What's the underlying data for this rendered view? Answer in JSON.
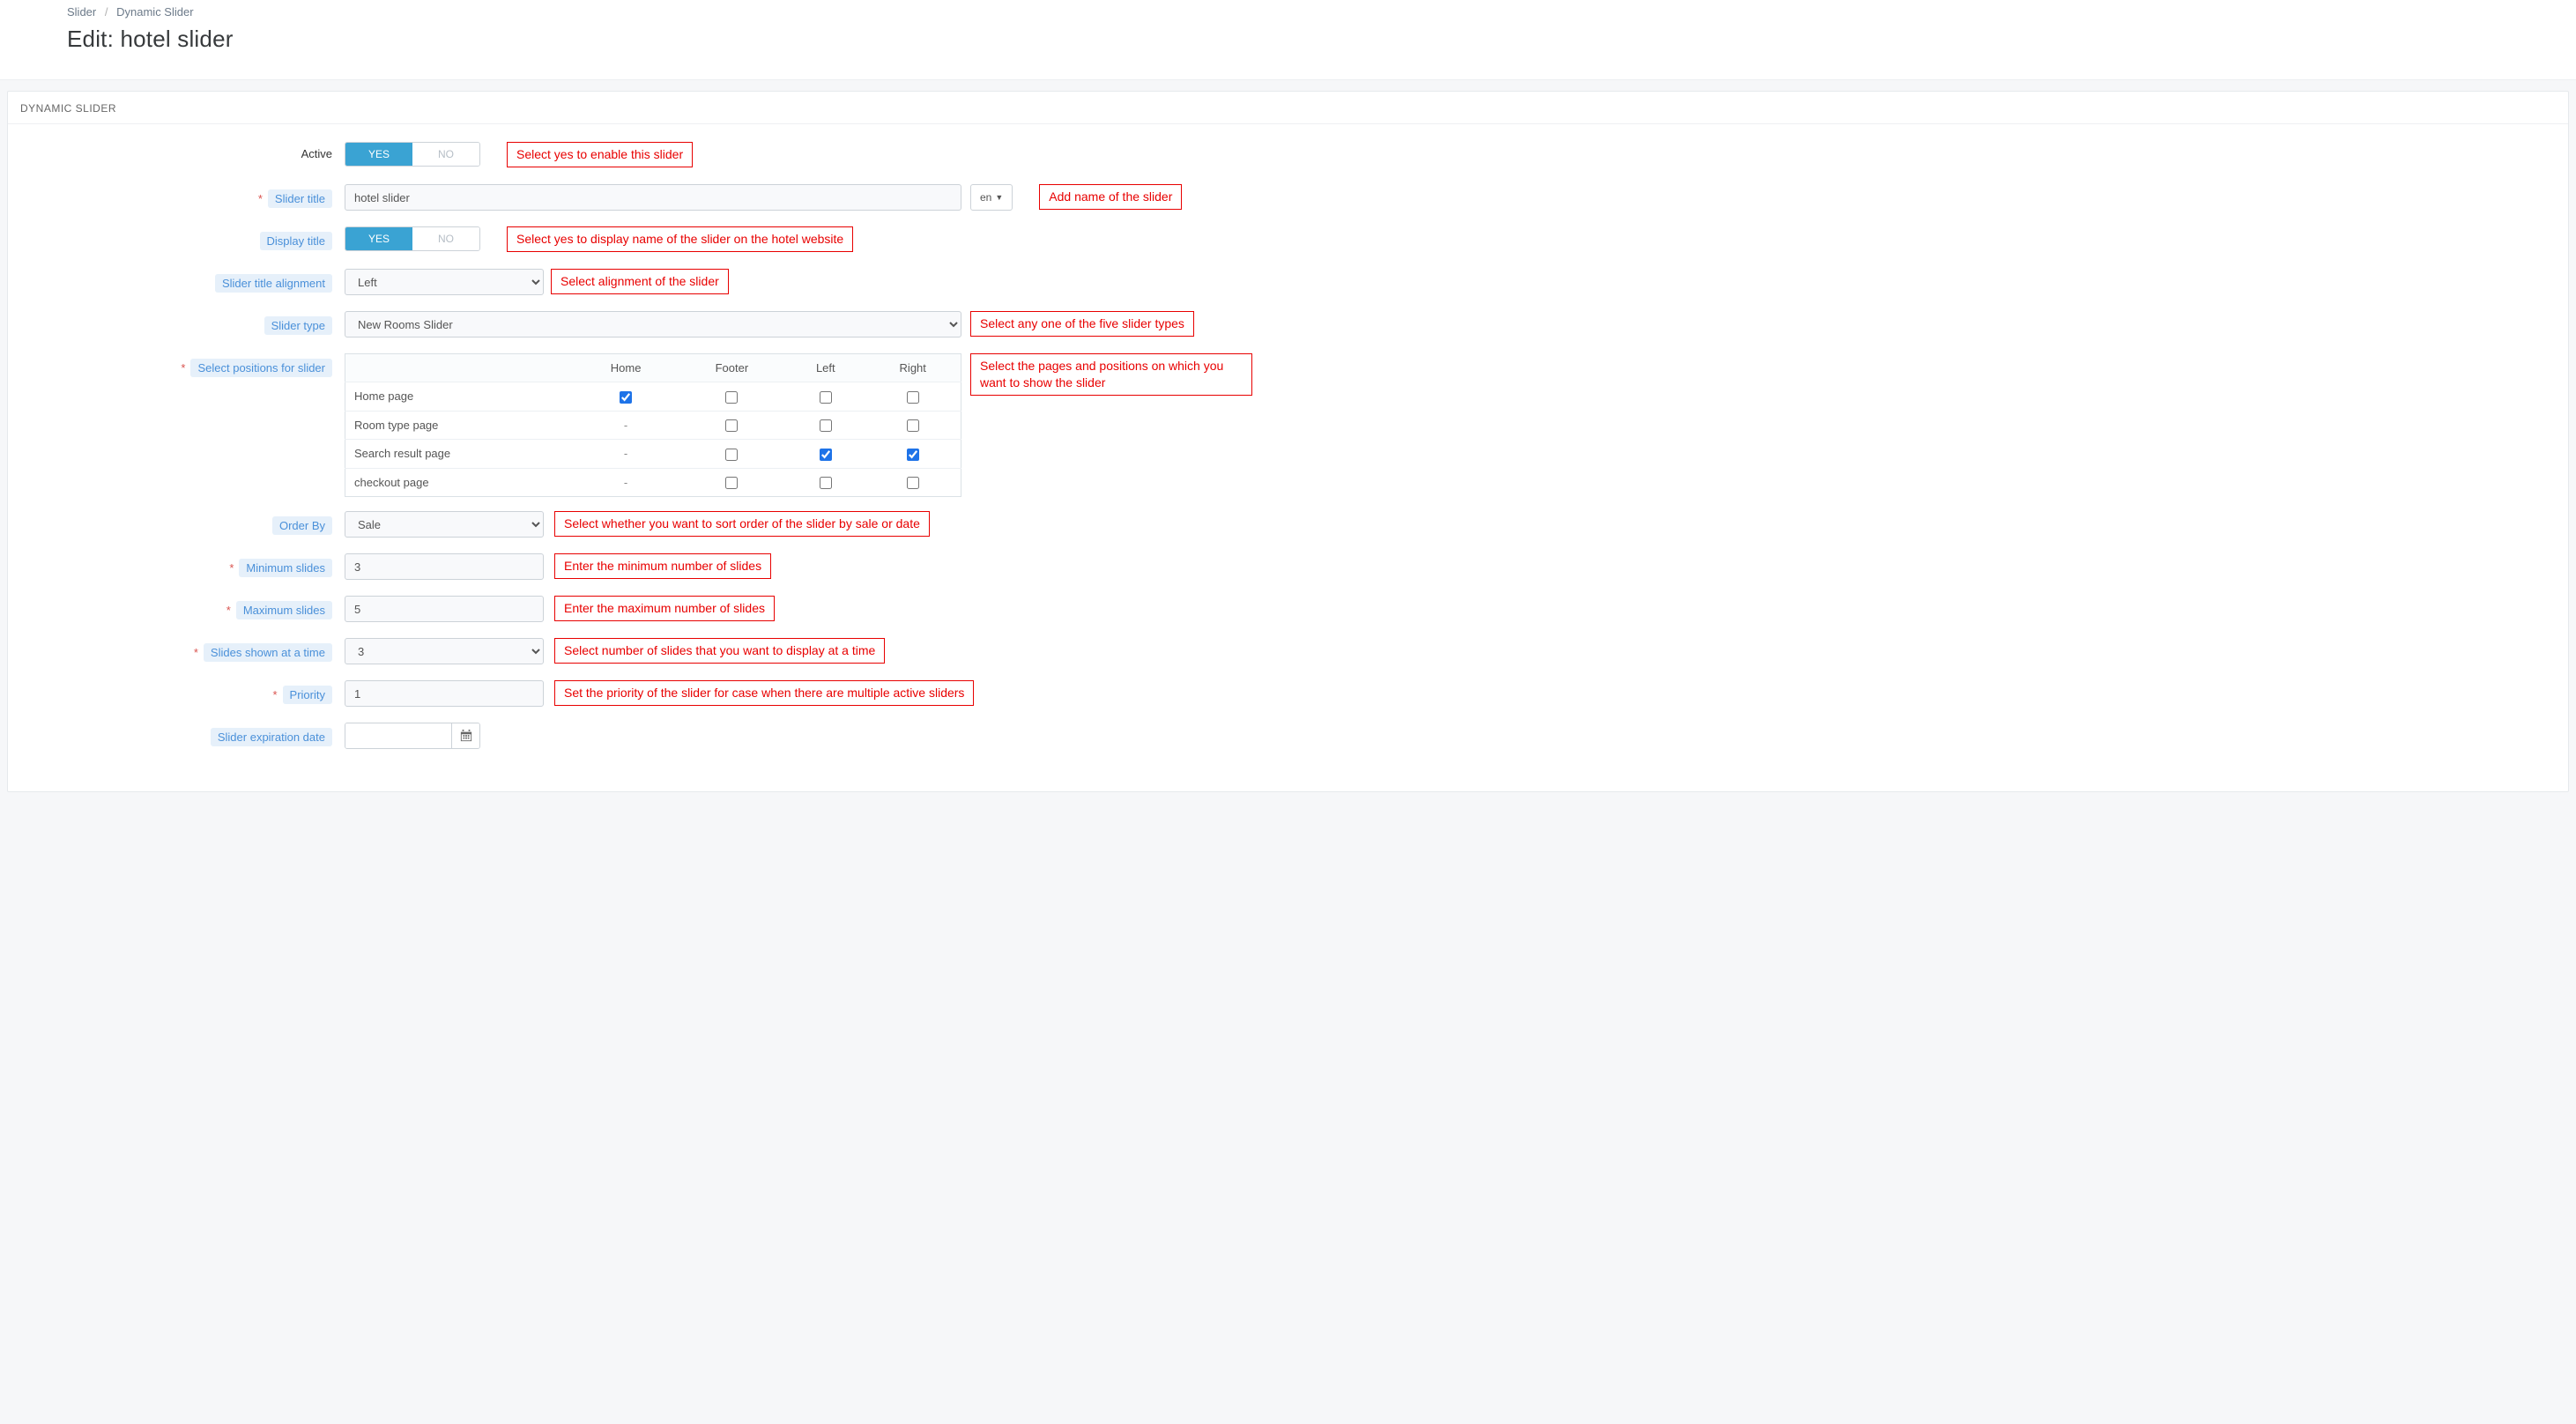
{
  "breadcrumb": {
    "root": "Slider",
    "leaf": "Dynamic Slider"
  },
  "page_title": "Edit: hotel slider",
  "panel_title": "DYNAMIC SLIDER",
  "lang_selected": "en",
  "toggle": {
    "yes": "YES",
    "no": "NO"
  },
  "labels": {
    "active": "Active",
    "slider_title": "Slider title",
    "display_title": "Display title",
    "title_align": "Slider title alignment",
    "slider_type": "Slider type",
    "select_positions": "Select positions for slider",
    "order_by": "Order By",
    "min_slides": "Minimum slides",
    "max_slides": "Maximum slides",
    "slides_at_time": "Slides shown at a time",
    "priority": "Priority",
    "expiration": "Slider expiration date"
  },
  "values": {
    "slider_title": "hotel slider",
    "title_align": "Left",
    "slider_type": "New Rooms Slider",
    "order_by": "Sale",
    "min_slides": "3",
    "max_slides": "5",
    "slides_at_time": "3",
    "priority": "1",
    "expiration": ""
  },
  "pos_headers": [
    "",
    "Home",
    "Footer",
    "Left",
    "Right"
  ],
  "pos_rows": [
    {
      "name": "Home page",
      "cells": [
        "check:true",
        "check:false",
        "check:false",
        "check:false"
      ]
    },
    {
      "name": "Room type page",
      "cells": [
        "dash",
        "check:false",
        "check:false",
        "check:false"
      ]
    },
    {
      "name": "Search result page",
      "cells": [
        "dash",
        "check:false",
        "check:true",
        "check:true"
      ]
    },
    {
      "name": "checkout page",
      "cells": [
        "dash",
        "check:false",
        "check:false",
        "check:false"
      ]
    }
  ],
  "notes": {
    "active": "Select yes to enable this slider",
    "slider_title": "Add name of the slider",
    "display_title": "Select yes to display name of the slider on the hotel website",
    "title_align": "Select alignment of the slider",
    "slider_type": "Select any one of the five slider types",
    "select_positions": "Select the pages and positions on which you want to show the slider",
    "order_by": "Select whether you want to sort order of the slider by sale or date",
    "min_slides": "Enter the minimum number of slides",
    "max_slides": "Enter the maximum number of slides",
    "slides_at_time": "Select number of slides that you want to display at a time",
    "priority": "Set the priority of the slider for case when there are multiple active sliders"
  }
}
